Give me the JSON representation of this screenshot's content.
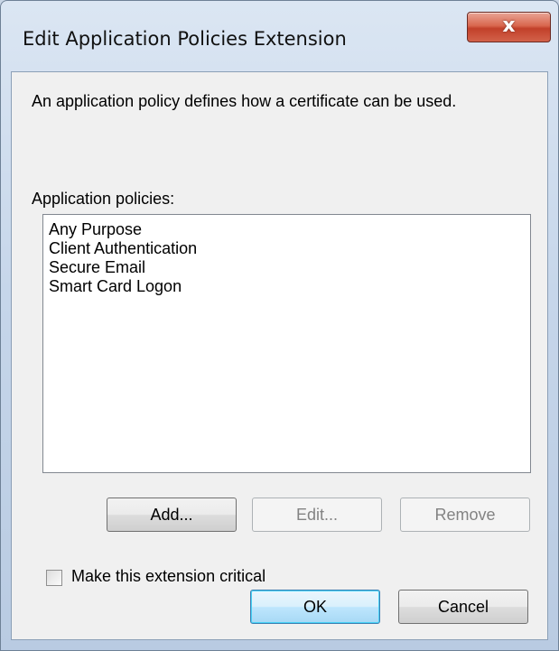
{
  "window": {
    "title": "Edit Application Policies Extension"
  },
  "titlebar": {
    "close_glyph": "x",
    "close_icon": "close-icon"
  },
  "content": {
    "description": "An application policy defines how a certificate can be used.",
    "policies_label": "Application policies:",
    "policies": [
      "Any Purpose",
      "Client Authentication",
      "Secure Email",
      "Smart Card Logon"
    ]
  },
  "buttons": {
    "add": "Add...",
    "edit": "Edit...",
    "remove": "Remove",
    "ok": "OK",
    "cancel": "Cancel"
  },
  "checkbox": {
    "label": "Make this extension critical",
    "checked": false
  }
}
